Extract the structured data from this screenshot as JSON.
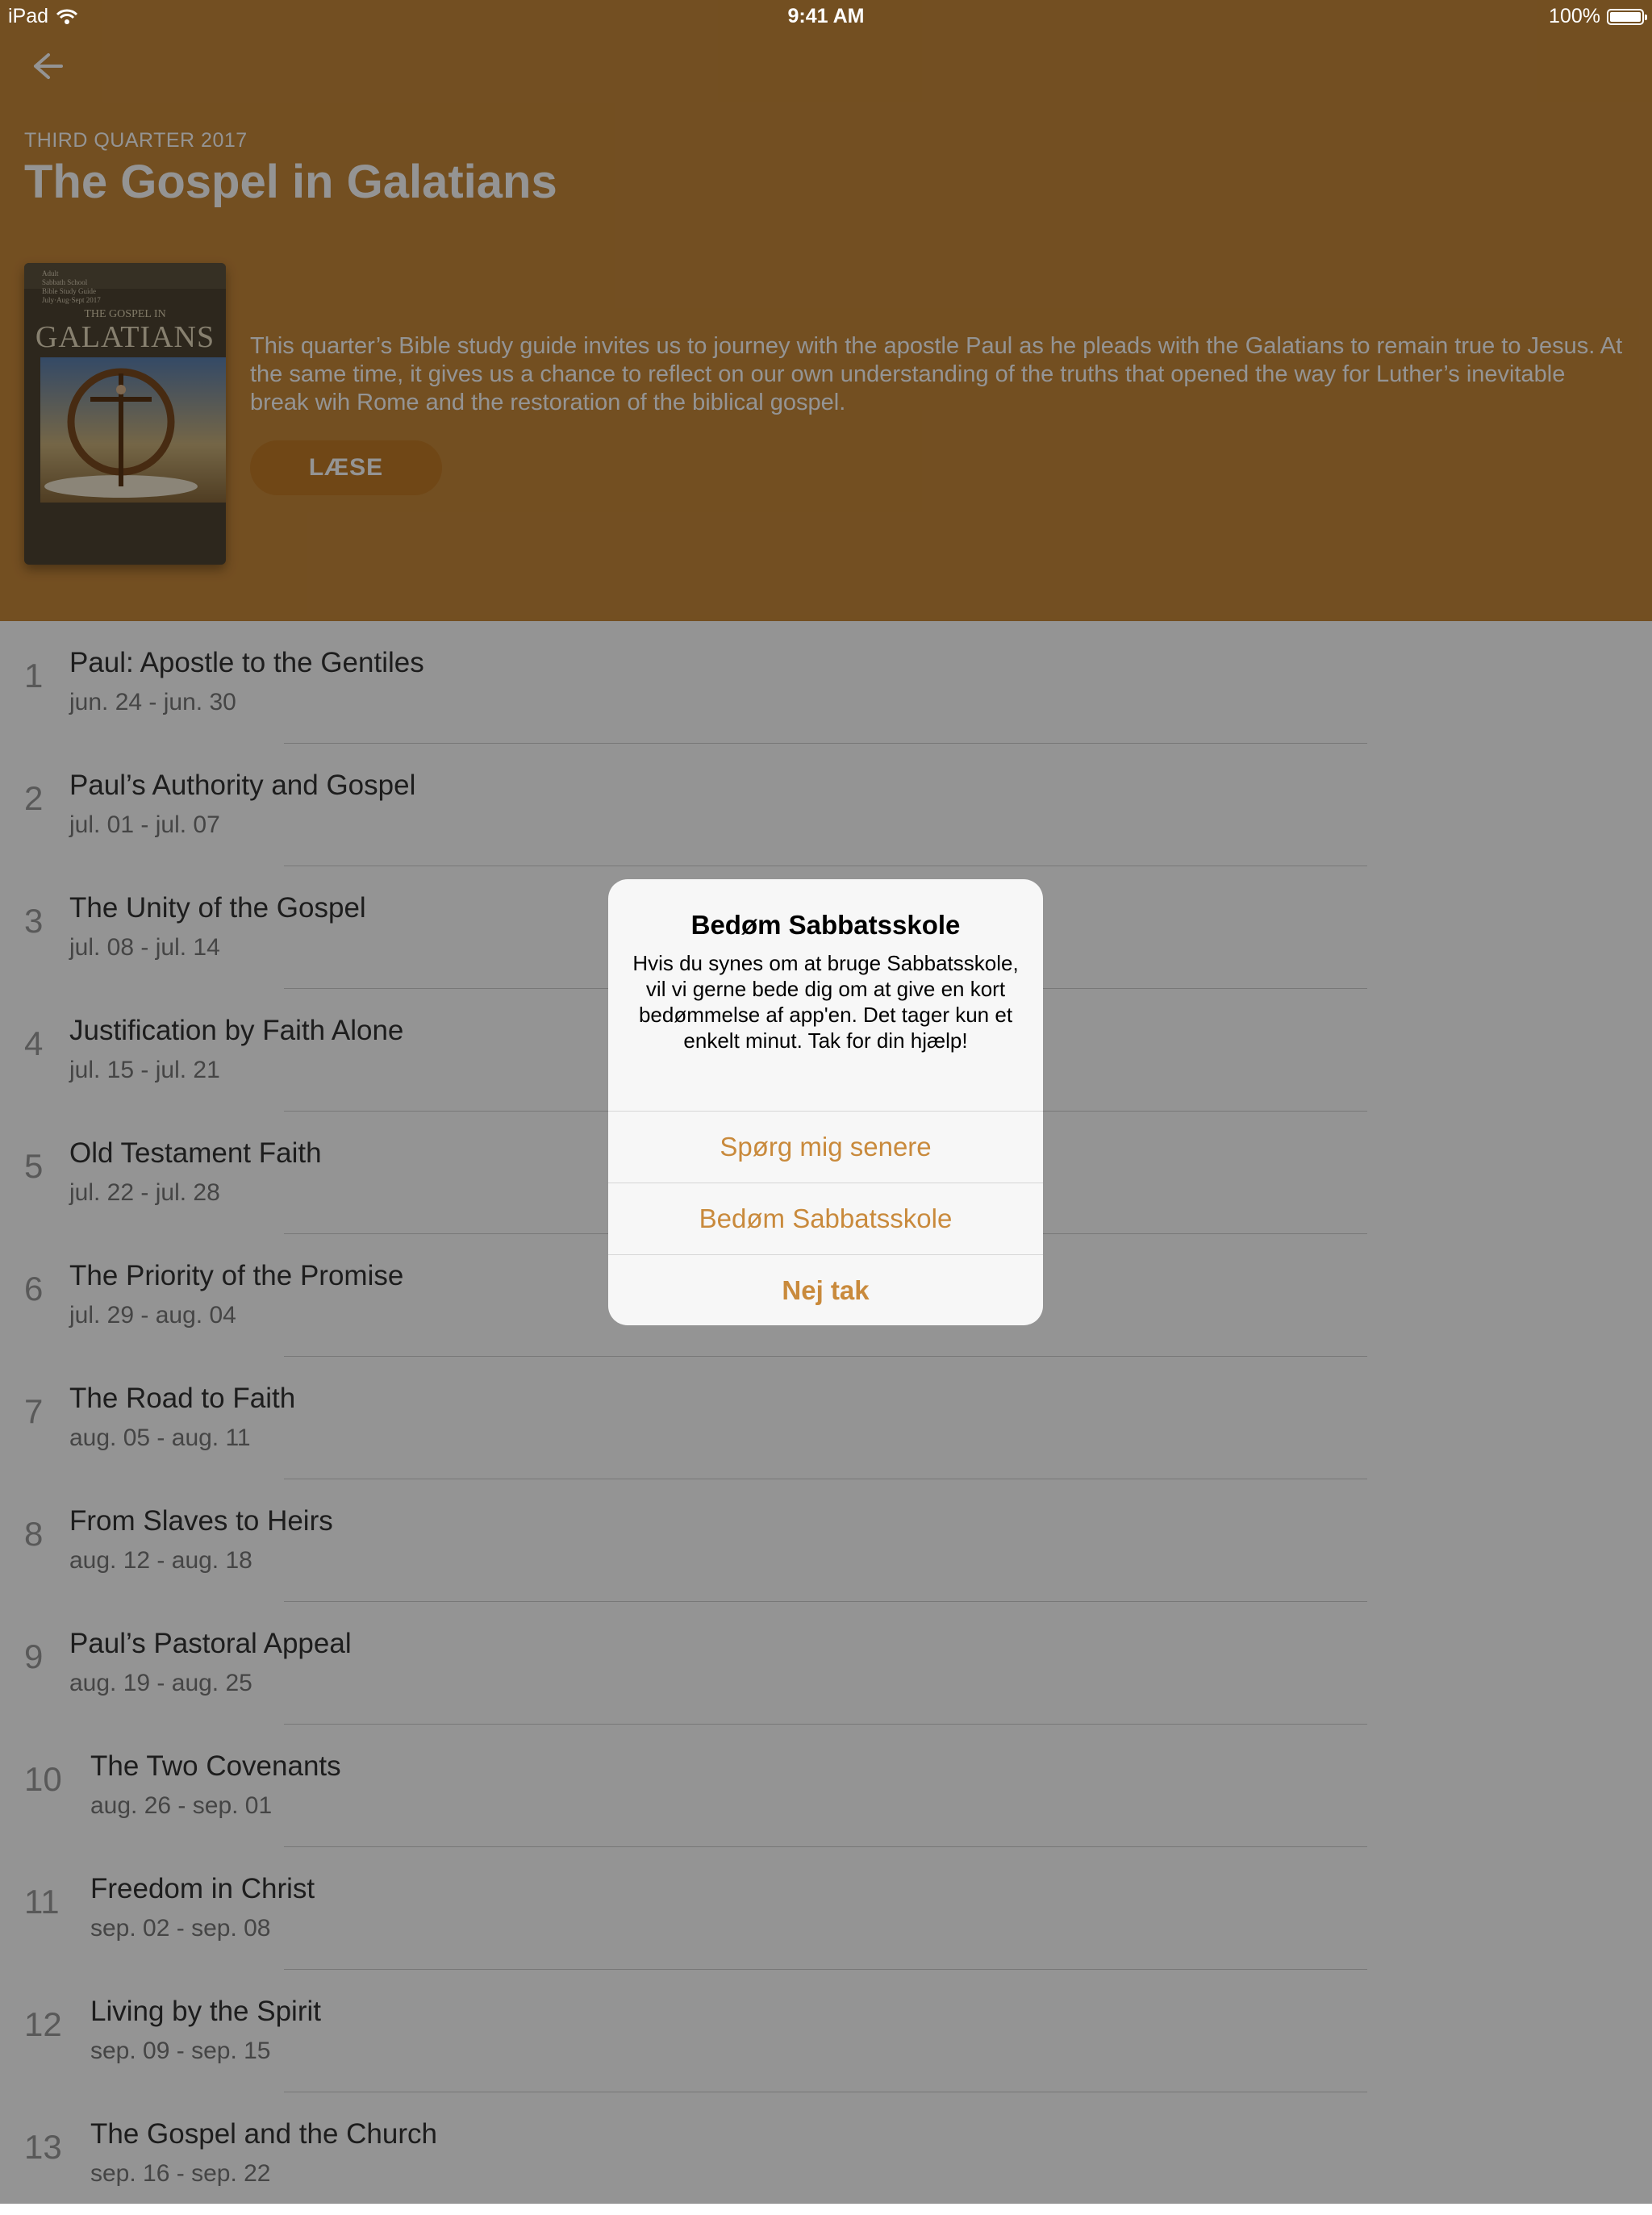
{
  "status_bar": {
    "device": "iPad",
    "time": "9:41 AM",
    "battery": "100%"
  },
  "header": {
    "quarter": "THIRD QUARTER 2017",
    "title": "The Gospel in Galatians",
    "description": "This quarter’s Bible study guide invites us to journey with the apostle Paul as he pleads with the Galatians to remain true to Jesus. At the same time, it gives us a chance to reflect on our own understanding of the truths that opened the way for Luther’s inevitable break wih Rome and the restoration of the biblical gospel.",
    "read_label": "LÆSE",
    "cover": {
      "top_text": "Adult\nSabbath School\nBible Study Guide\nJuly·Aug·Sept 2017",
      "subtitle": "THE GOSPEL IN",
      "main": "GALATIANS"
    }
  },
  "lessons": [
    {
      "number": "1",
      "title": "Paul: Apostle to the Gentiles",
      "dates": "jun. 24 - jun. 30"
    },
    {
      "number": "2",
      "title": "Paul’s Authority and Gospel",
      "dates": "jul. 01 - jul. 07"
    },
    {
      "number": "3",
      "title": "The Unity of the Gospel",
      "dates": "jul. 08 - jul. 14"
    },
    {
      "number": "4",
      "title": "Justification by Faith Alone",
      "dates": "jul. 15 - jul. 21"
    },
    {
      "number": "5",
      "title": "Old Testament Faith",
      "dates": "jul. 22 - jul. 28"
    },
    {
      "number": "6",
      "title": "The Priority of the Promise",
      "dates": "jul. 29 - aug. 04"
    },
    {
      "number": "7",
      "title": "The Road to Faith",
      "dates": "aug. 05 - aug. 11"
    },
    {
      "number": "8",
      "title": "From Slaves to Heirs",
      "dates": "aug. 12 - aug. 18"
    },
    {
      "number": "9",
      "title": "Paul’s Pastoral Appeal",
      "dates": "aug. 19 - aug. 25"
    },
    {
      "number": "10",
      "title": "The Two Covenants",
      "dates": "aug. 26 - sep. 01"
    },
    {
      "number": "11",
      "title": "Freedom in Christ",
      "dates": "sep. 02 - sep. 08"
    },
    {
      "number": "12",
      "title": "Living by the Spirit",
      "dates": "sep. 09 - sep. 15"
    },
    {
      "number": "13",
      "title": "The Gospel and the Church",
      "dates": "sep. 16 - sep. 22"
    }
  ],
  "alert": {
    "title": "Bedøm Sabbatsskole",
    "message": "Hvis du synes om at bruge Sabbatsskole, vil vi gerne bede dig om at give en kort bedømmelse af app'en. Det tager kun et enkelt minut. Tak for din hjælp!",
    "actions": {
      "later": "Spørg mig senere",
      "rate": "Bedøm Sabbatsskole",
      "no": "Nej tak"
    }
  },
  "colors": {
    "header": "#c7883a",
    "button": "#c17a26",
    "alert_action": "#c98a3c"
  }
}
